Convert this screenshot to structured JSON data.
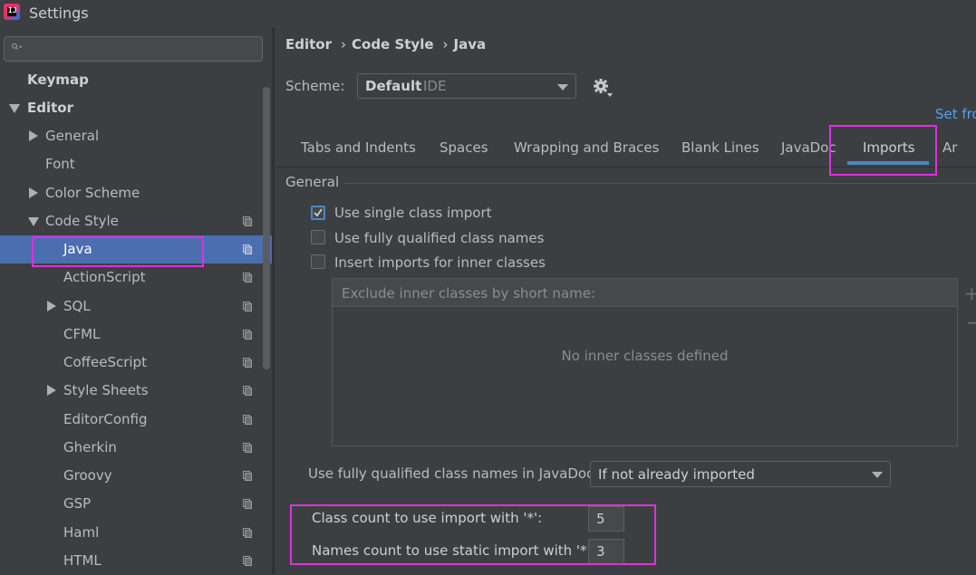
{
  "window": {
    "title": "Settings",
    "app_icon_text": "IJ"
  },
  "search": {
    "placeholder": ""
  },
  "sidebar": {
    "items": [
      {
        "label": "Keymap"
      },
      {
        "label": "Editor"
      },
      {
        "label": "General"
      },
      {
        "label": "Font"
      },
      {
        "label": "Color Scheme"
      },
      {
        "label": "Code Style"
      },
      {
        "label": "Java"
      },
      {
        "label": "ActionScript"
      },
      {
        "label": "SQL"
      },
      {
        "label": "CFML"
      },
      {
        "label": "CoffeeScript"
      },
      {
        "label": "Style Sheets"
      },
      {
        "label": "EditorConfig"
      },
      {
        "label": "Gherkin"
      },
      {
        "label": "Groovy"
      },
      {
        "label": "GSP"
      },
      {
        "label": "Haml"
      },
      {
        "label": "HTML"
      }
    ],
    "selected": "Java"
  },
  "breadcrumb": {
    "items": [
      "Editor",
      "Code Style",
      "Java"
    ],
    "separator": "›"
  },
  "scheme": {
    "label": "Scheme:",
    "name": "Default",
    "type": "IDE"
  },
  "set_from": {
    "label": "Set fro"
  },
  "tabs": {
    "items": [
      "Tabs and Indents",
      "Spaces",
      "Wrapping and Braces",
      "Blank Lines",
      "JavaDoc",
      "Imports",
      "Ar"
    ],
    "active": "Imports"
  },
  "general": {
    "title": "General",
    "options": [
      {
        "label": "Use single class import",
        "checked": true
      },
      {
        "label": "Use fully qualified class names",
        "checked": false
      },
      {
        "label": "Insert imports for inner classes",
        "checked": false
      }
    ],
    "exclude_header": "Exclude inner classes by short name:",
    "empty_text": "No inner classes defined",
    "add_symbol": "+",
    "remove_symbol": "−"
  },
  "javadoc": {
    "label": "Use fully qualified class names in JavaDoc:",
    "value": "If not already imported"
  },
  "counts": {
    "class_label": "Class count to use import with '*':",
    "class_value": "5",
    "names_label": "Names count to use static import with '*':",
    "names_value": "3"
  },
  "colors": {
    "highlight": "#e02fe0",
    "selection": "#4b6eaf",
    "accent": "#4a88c7",
    "link": "#589df6"
  }
}
